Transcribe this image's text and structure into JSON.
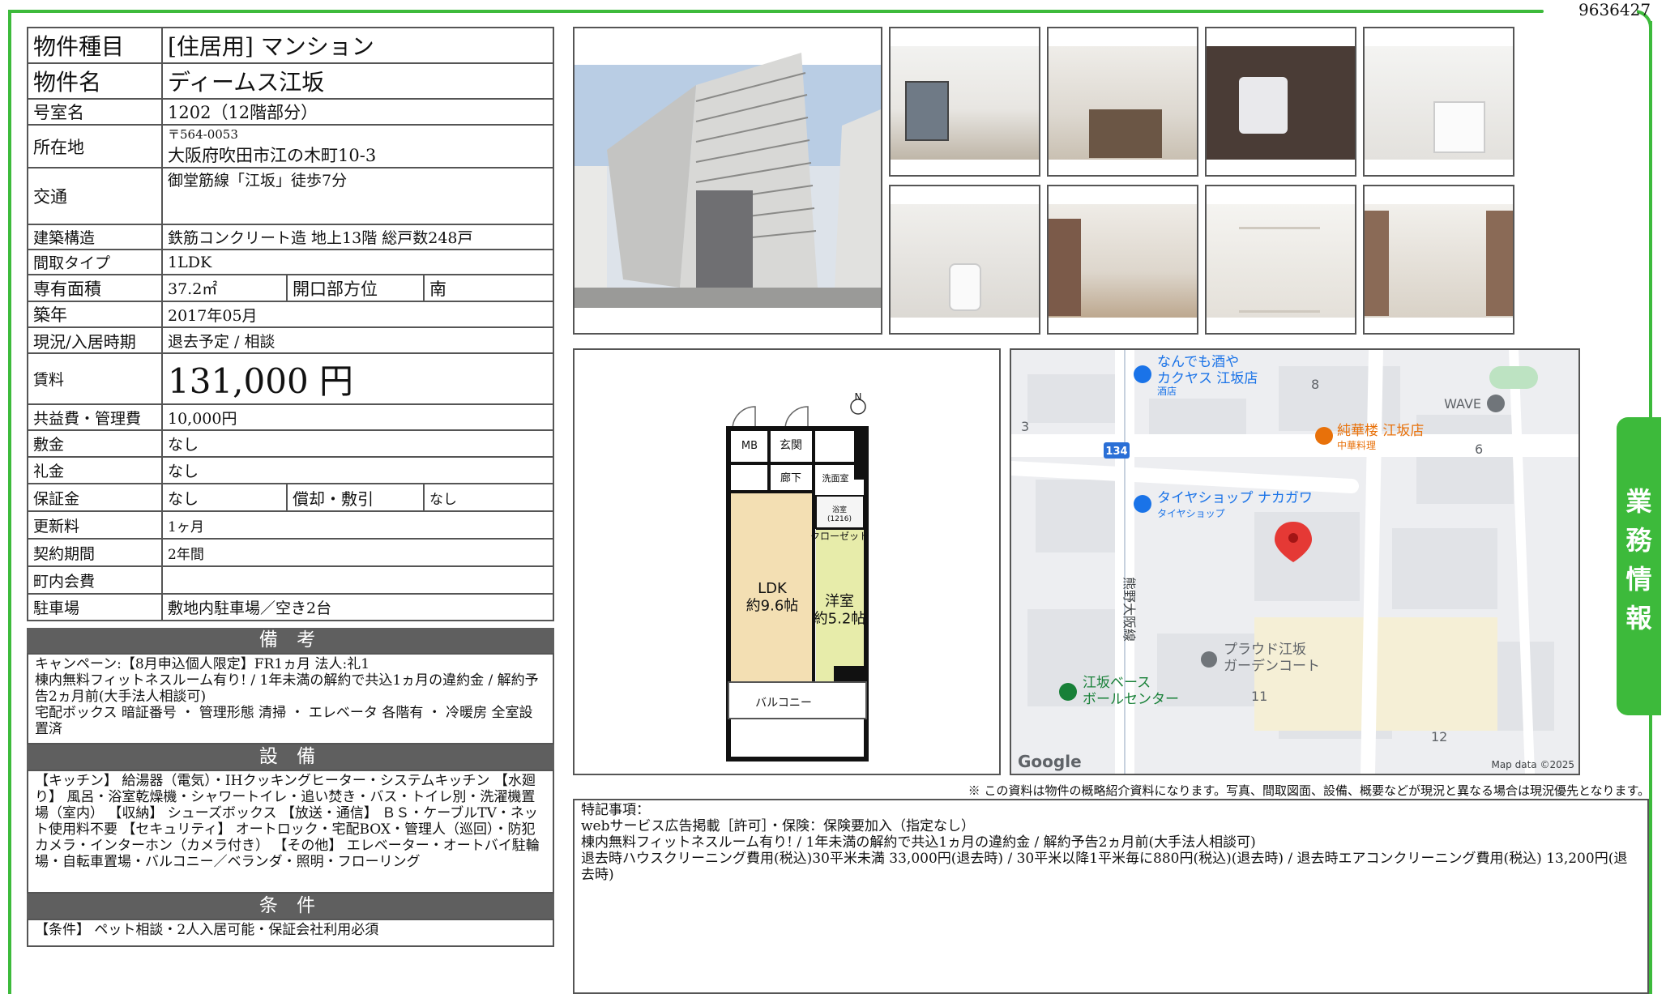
{
  "doc_id": "9636427",
  "property": {
    "rows": [
      {
        "label": "物件種目",
        "value": "[住居用] マンション"
      },
      {
        "label": "物件名",
        "value": "ディームス江坂"
      },
      {
        "label": "号室名",
        "value": "1202（12階部分）"
      },
      {
        "label": "所在地",
        "postal": "〒564-0053",
        "value": "大阪府吹田市江の木町10-3"
      },
      {
        "label": "交通",
        "value": "御堂筋線「江坂」徒歩7分"
      },
      {
        "label": "建築構造",
        "value": "鉄筋コンクリート造 地上13階 総戸数248戸"
      },
      {
        "label": "間取タイプ",
        "value": "1LDK"
      },
      {
        "label": "専有面積",
        "value": "37.2㎡",
        "label2": "開口部方位",
        "value2": "南"
      },
      {
        "label": "築年",
        "value": "2017年05月"
      },
      {
        "label": "現況/入居時期",
        "value": "退去予定 / 相談"
      },
      {
        "label": "賃料",
        "value": "131,000 円"
      },
      {
        "label": "共益費・管理費",
        "value": "10,000円"
      },
      {
        "label": "敷金",
        "value": "なし"
      },
      {
        "label": "礼金",
        "value": "なし"
      },
      {
        "label": "保証金",
        "value": "なし",
        "label2": "償却・敷引",
        "value2": "なし"
      },
      {
        "label": "更新料",
        "value": "1ヶ月"
      },
      {
        "label": "契約期間",
        "value": "2年間"
      },
      {
        "label": "町内会費",
        "value": ""
      },
      {
        "label": "駐車場",
        "value": "敷地内駐車場／空き2台"
      }
    ]
  },
  "bikou": {
    "heading": "備 考",
    "text": "キャンペーン:【8月申込個人限定】FR1ヵ月 法人:礼1\n棟内無料フィットネスルーム有り! / 1年未満の解約で共込1ヵ月の違約金 / 解約予告2ヵ月前(大手法人相談可)\n宅配ボックス 暗証番号 ・ 管理形態 清掃 ・ エレベータ 各階有 ・ 冷暖房 全室設置済"
  },
  "setsubi": {
    "heading": "設 備",
    "text": "【キッチン】 給湯器（電気）・IHクッキングヒーター・システムキッチン 【水廻り】 風呂・浴室乾燥機・シャワートイレ・追い焚き・バス・トイレ別・洗濯機置場（室内） 【収納】 シューズボックス 【放送・通信】 ＢＳ・ケーブルTV・ネット使用料不要 【セキュリティ】 オートロック・宅配BOX・管理人（巡回）・防犯カメラ・インターホン（カメラ付き） 【その他】 エレベーター・オートバイ駐輪場・自転車置場・バルコニー／ベランダ・照明・フローリング"
  },
  "jouken": {
    "heading": "条 件",
    "text": "【条件】 ペット相談・2人入居可能・保証会社利用必須"
  },
  "floorplan": {
    "mb": "MB",
    "genkan": "玄関",
    "rouka": "廊下",
    "senmen": "洗面室",
    "yokushitsu": "浴室\n(1216)",
    "closet": "クローゼット",
    "ldk": "LDK\n約9.6帖",
    "youshitsu": "洋室\n約5.2帖",
    "balcony": "バルコニー",
    "north": "N"
  },
  "map": {
    "labels": [
      {
        "text": "なんでも酒や\nカクヤス 江坂店",
        "sub": "酒店",
        "color": "#1a73e8"
      },
      {
        "text": "純華楼 江坂店",
        "sub": "中華料理",
        "color": "#e8710a"
      },
      {
        "text": "タイヤショップ ナカガワ",
        "sub": "タイヤショップ",
        "color": "#1a73e8"
      },
      {
        "text": "プラウド江坂\nガーデンコート",
        "sub": "",
        "color": "#5f6368"
      },
      {
        "text": "江坂ベース\nボールセンター",
        "sub": "",
        "color": "#188038"
      },
      {
        "text": "WAVE",
        "sub": "",
        "color": "#5f6368"
      },
      {
        "text": "熊野大阪線",
        "sub": "",
        "color": "#3c4043"
      }
    ],
    "block_numbers": [
      "8",
      "3",
      "6",
      "11",
      "12"
    ],
    "route_badge": "134",
    "google": "Google",
    "copyright": "Map data ©2025"
  },
  "disclaimer": "※ この資料は物件の概略紹介資料になります。写真、間取図面、設備、概要などが現況と異なる場合は現況優先となります。",
  "remarks": "特記事項：\nwebサービス広告掲載［許可］・保険：保険要加入（指定なし）\n棟内無料フィットネスルーム有り! / 1年未満の解約で共込1ヵ月の違約金 / 解約予告2ヵ月前(大手法人相談可)\n退去時ハウスクリーニング費用(税込)30平米未満 33,000円(退去時) / 30平米以降1平米毎に880円(税込)(退去時) / 退去時エアコンクリーニング費用(税込) 13,200円(退去時)",
  "side_tab": "業務情報",
  "colors": {
    "accent_green": "#3dba3b",
    "section_gray": "#5f5f5f",
    "map_pin": "#e53935"
  }
}
